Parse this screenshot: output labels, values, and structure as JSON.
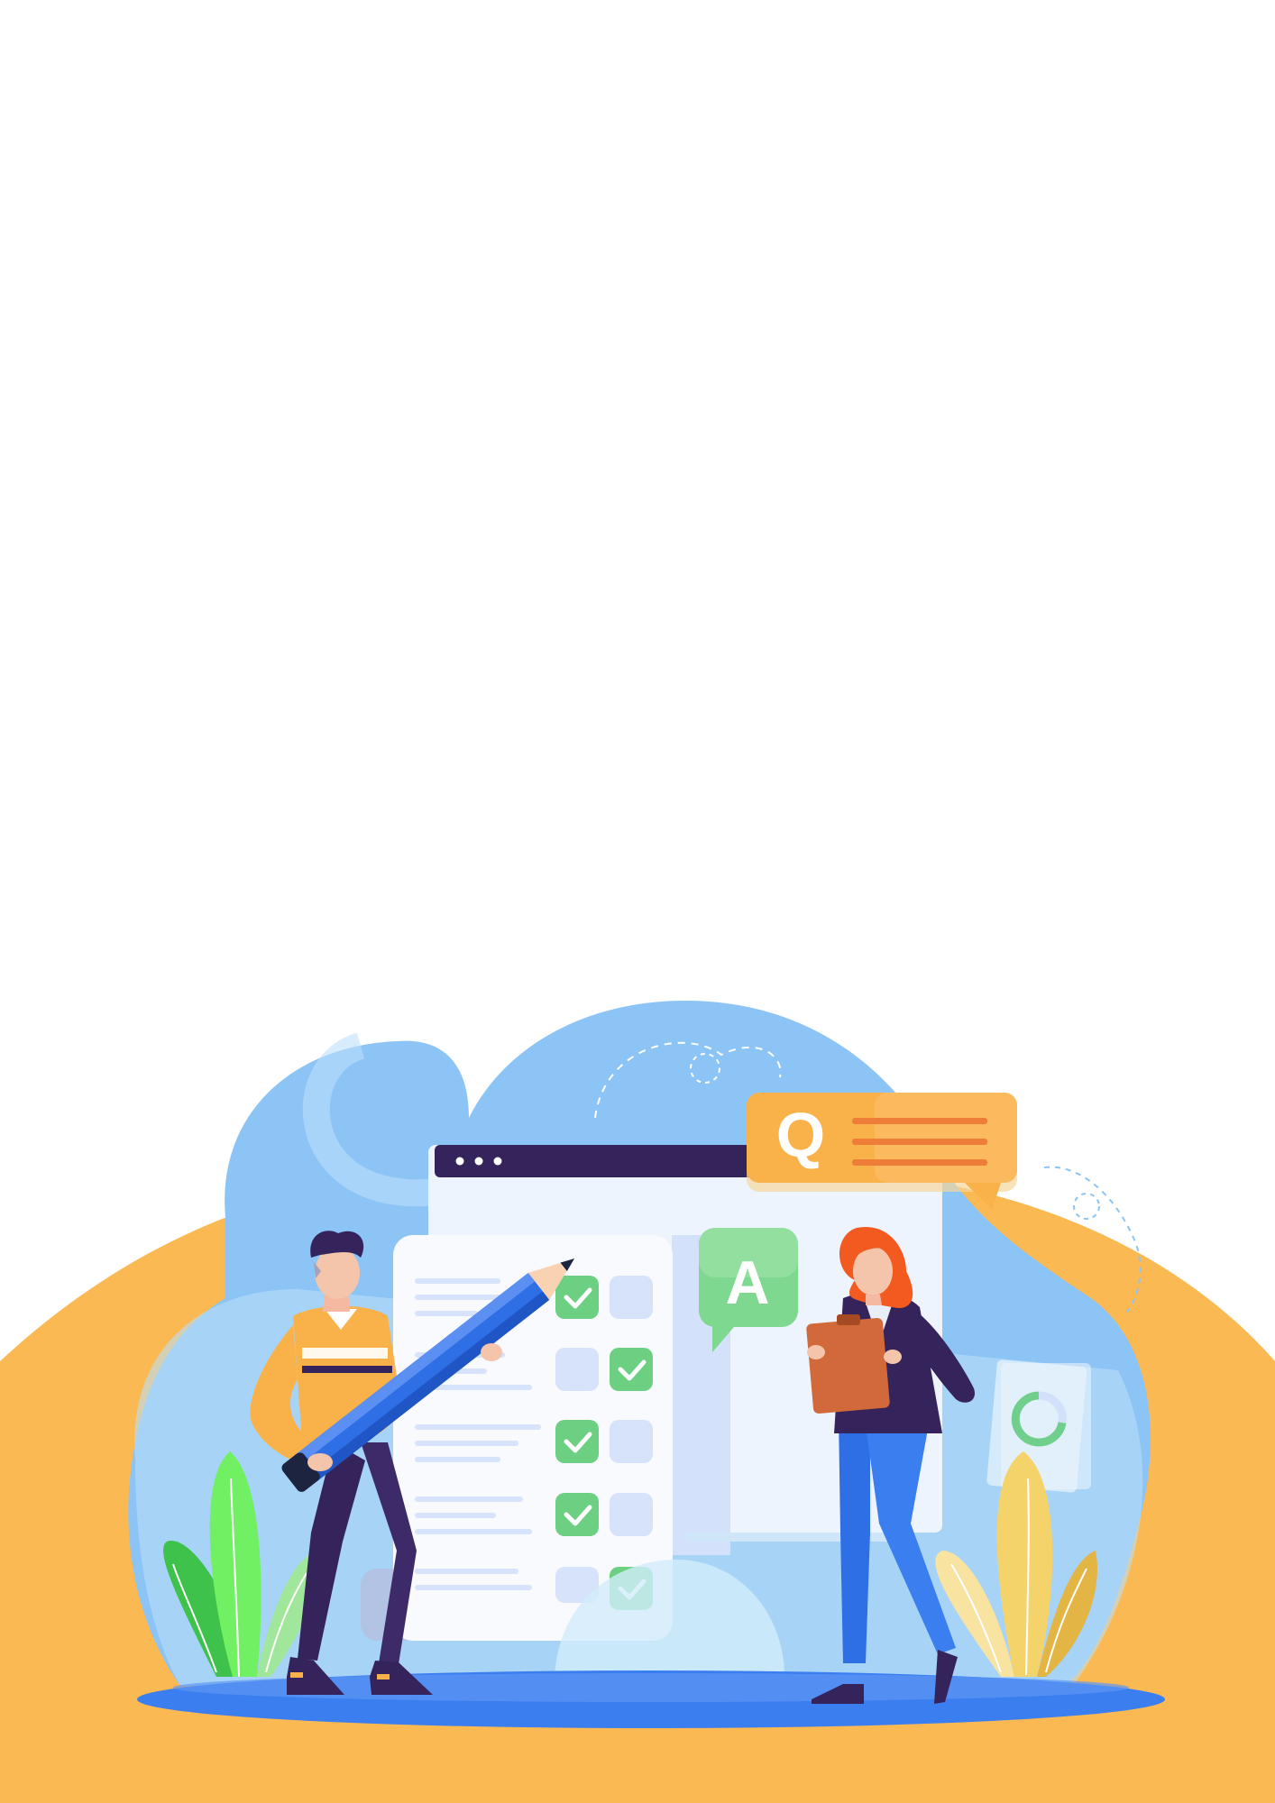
{
  "illustration": {
    "answer_bubble": {
      "letter": "A"
    },
    "question_bubble": {
      "letter": "Q"
    },
    "browser_window": {
      "dots": 3
    },
    "checklist": {
      "rows": 5,
      "checked_left": [
        true,
        false,
        true,
        true,
        false
      ],
      "checked_right": [
        false,
        true,
        false,
        false,
        true
      ]
    }
  },
  "colors": {
    "background": "#ffffff",
    "orange_hill": "#fbb954",
    "blue_blob": "#8cc4f5",
    "light_blue": "#b9dff7",
    "navy": "#35235b",
    "ground_blue": "#3b7ef0",
    "check_green": "#6ccf82",
    "question_orange": "#f9b24a",
    "answer_green": "#7fd88f",
    "pencil_blue": "#2f6fe6",
    "plant_green": "#3fc24b",
    "plant_yellow": "#f5d36b"
  }
}
